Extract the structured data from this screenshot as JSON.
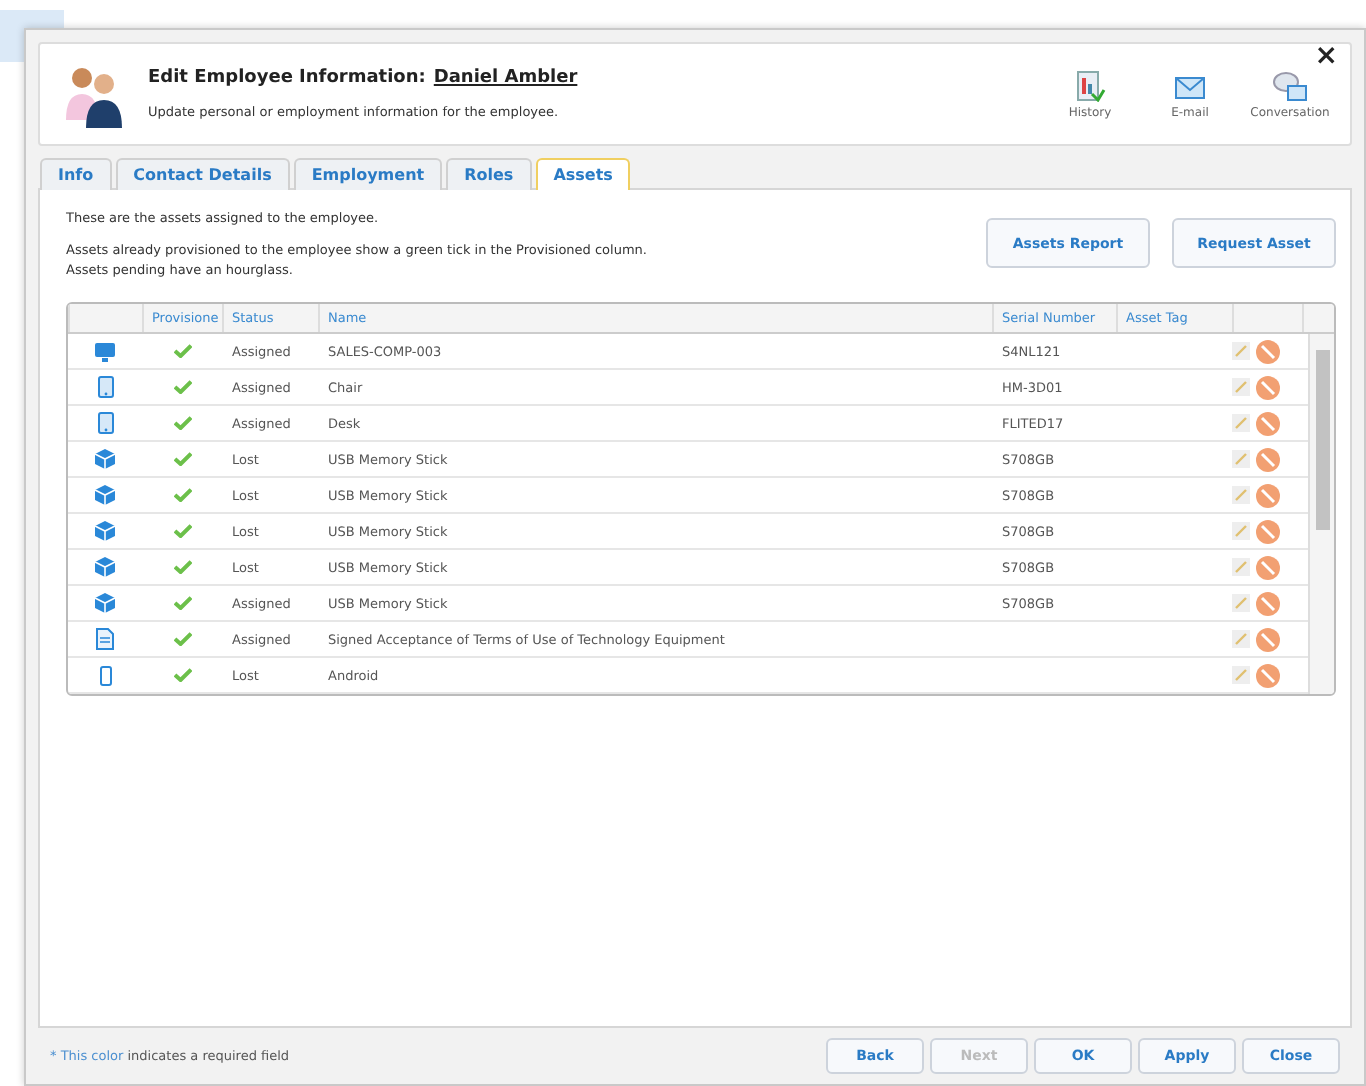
{
  "header": {
    "title": "Edit Employee Information:",
    "employee": "Daniel Ambler",
    "subtitle": "Update personal or employment information for the employee.",
    "actions": [
      {
        "label": "History",
        "kind": "history"
      },
      {
        "label": "E-mail",
        "kind": "email"
      },
      {
        "label": "Conversation",
        "kind": "conversation"
      }
    ],
    "close": "×"
  },
  "tabs": [
    {
      "label": "Info",
      "selected": false
    },
    {
      "label": "Contact Details",
      "selected": false
    },
    {
      "label": "Employment",
      "selected": false
    },
    {
      "label": "Roles",
      "selected": false
    },
    {
      "label": "Assets",
      "selected": true
    }
  ],
  "intro": "These are the assets assigned to the employee.",
  "note": [
    "Assets already provisioned to the employee show a green tick in the Provisioned column.",
    "Assets pending have an hourglass."
  ],
  "buttons": [
    "Assets Report",
    "Request Asset"
  ],
  "table": {
    "columns": [
      "Provisione",
      "Status",
      "Name",
      "Serial Number",
      "Asset Tag"
    ],
    "rows": [
      {
        "kind": "monitor",
        "provisioned": true,
        "status": "Assigned",
        "name": "SALES-COMP-003",
        "serial": "S4NL121"
      },
      {
        "kind": "tablet",
        "provisioned": true,
        "status": "Assigned",
        "name": "Chair",
        "serial": "HM-3D01"
      },
      {
        "kind": "tablet",
        "provisioned": true,
        "status": "Assigned",
        "name": "Desk",
        "serial": "FLITED17"
      },
      {
        "kind": "box",
        "provisioned": true,
        "status": "Lost",
        "name": "USB Memory Stick",
        "serial": "S708GB"
      },
      {
        "kind": "box",
        "provisioned": true,
        "status": "Lost",
        "name": "USB Memory Stick",
        "serial": "S708GB"
      },
      {
        "kind": "box",
        "provisioned": true,
        "status": "Lost",
        "name": "USB Memory Stick",
        "serial": "S708GB"
      },
      {
        "kind": "box",
        "provisioned": true,
        "status": "Lost",
        "name": "USB Memory Stick",
        "serial": "S708GB"
      },
      {
        "kind": "box",
        "provisioned": true,
        "status": "Assigned",
        "name": "USB Memory Stick",
        "serial": "S708GB"
      },
      {
        "kind": "document",
        "provisioned": true,
        "status": "Assigned",
        "name": "Signed Acceptance of Terms of Use of Technology Equipment"
      },
      {
        "kind": "phone",
        "provisioned": true,
        "status": "Lost",
        "name": "Android"
      }
    ]
  },
  "footer": {
    "marker": "* This color",
    "legend": "indicates a required field",
    "buttons": [
      {
        "label": "Back",
        "disabled": false
      },
      {
        "label": "Next",
        "disabled": true
      },
      {
        "label": "OK",
        "disabled": false
      },
      {
        "label": "Apply",
        "disabled": false
      },
      {
        "label": "Close",
        "disabled": false
      }
    ]
  }
}
